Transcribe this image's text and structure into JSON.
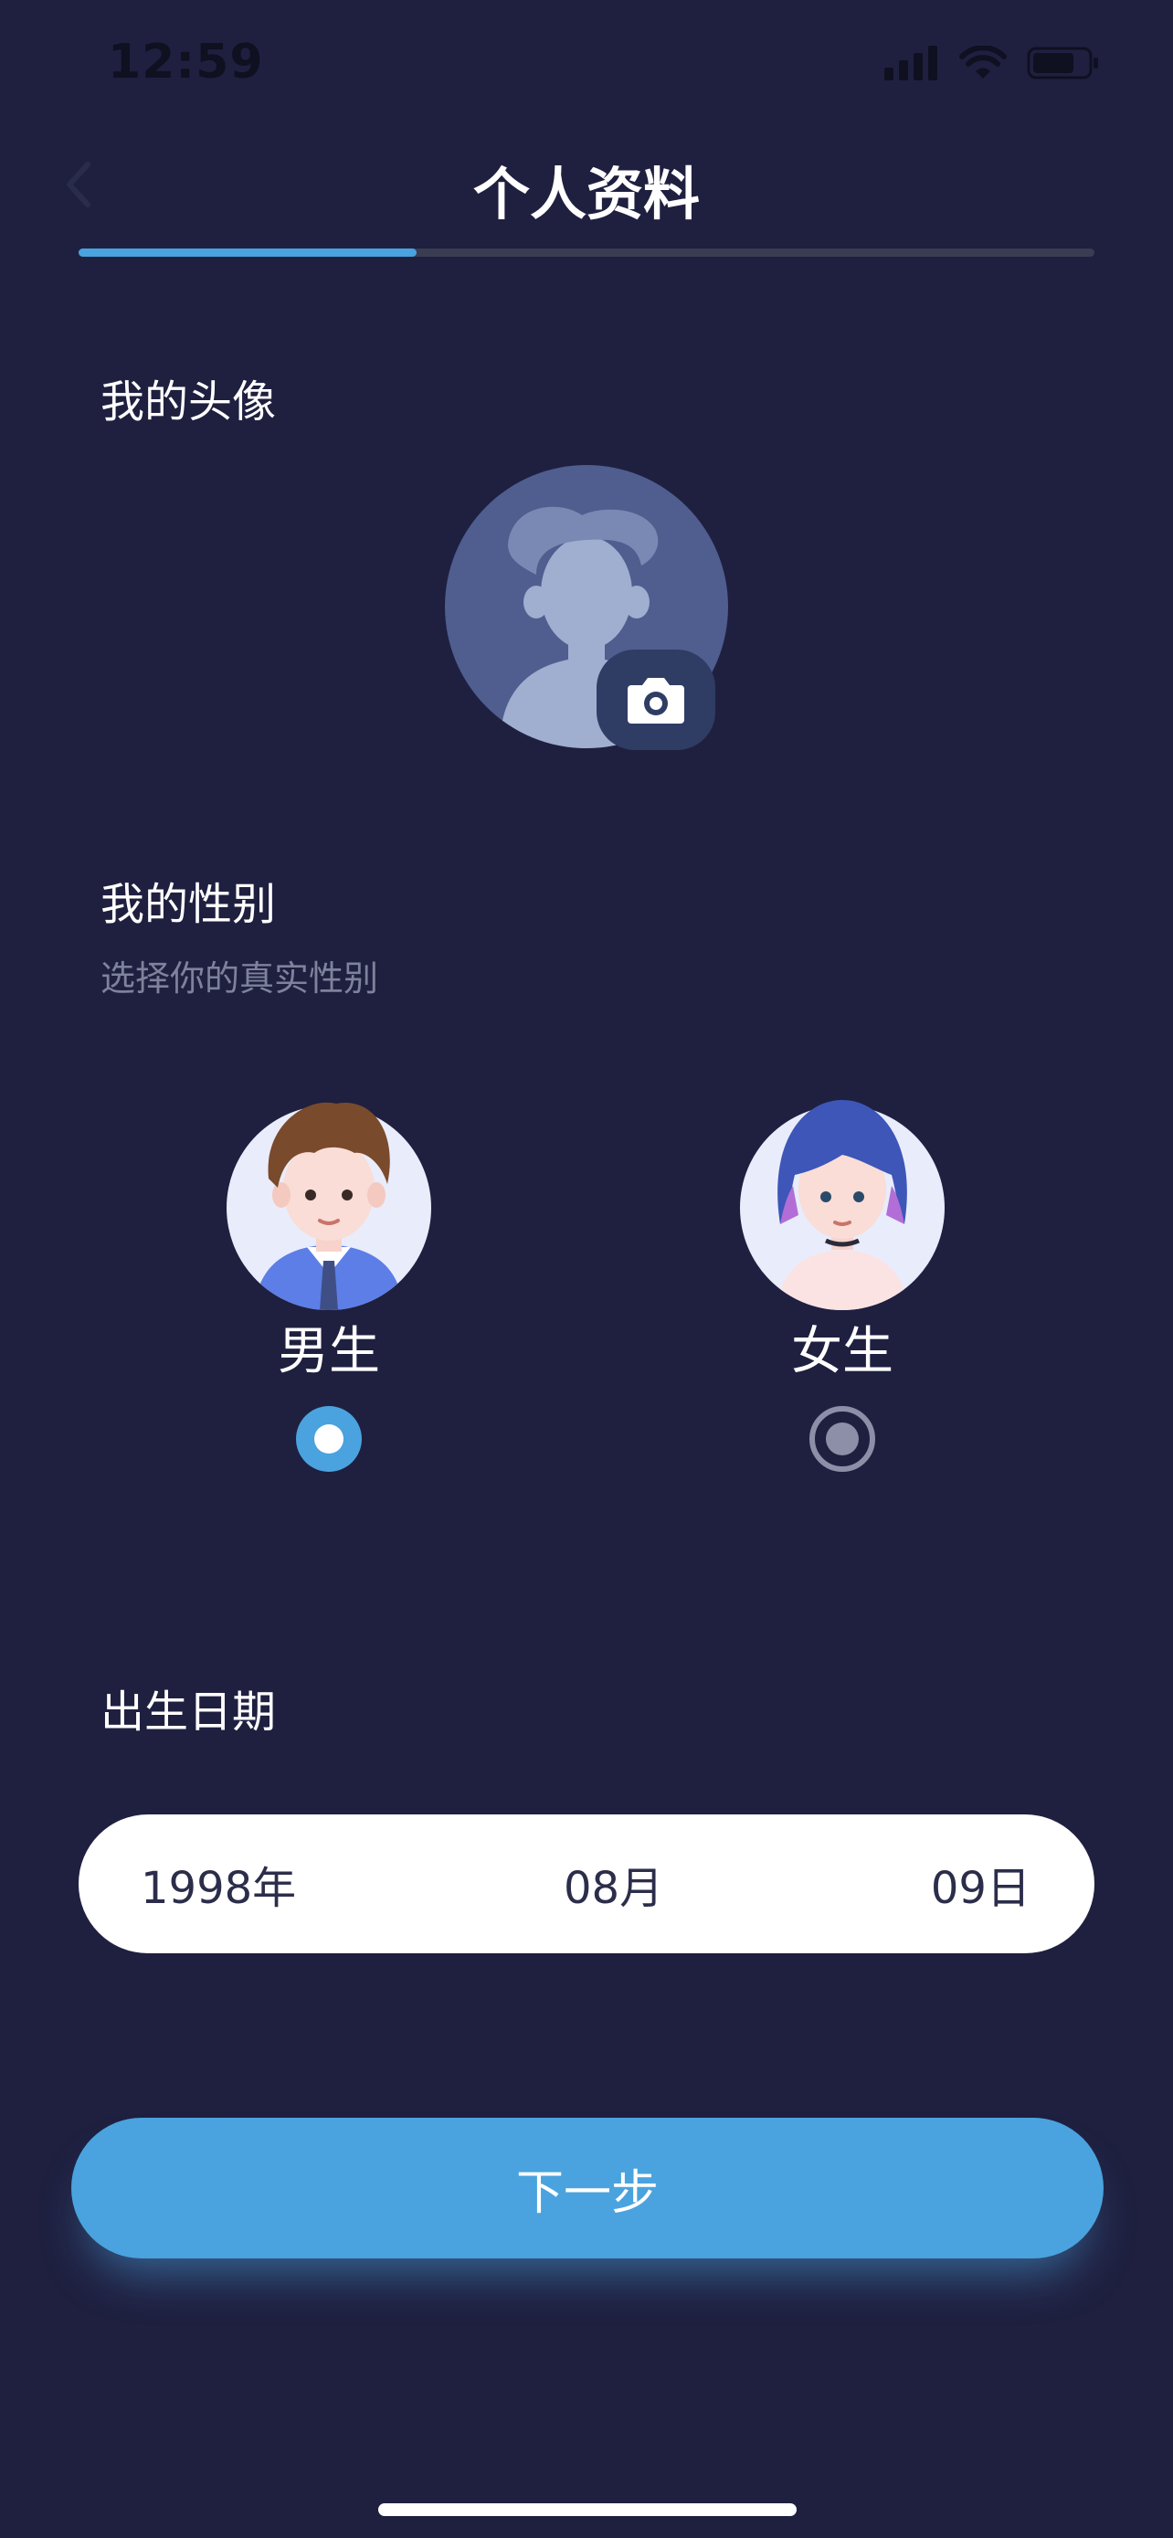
{
  "status": {
    "time": "12:59"
  },
  "header": {
    "title": "个人资料",
    "progress": 0.333
  },
  "avatar_section": {
    "label": "我的头像"
  },
  "gender_section": {
    "label": "我的性别",
    "subtitle": "选择你的真实性别",
    "options": [
      {
        "label": "男生",
        "selected": true
      },
      {
        "label": "女生",
        "selected": false
      }
    ]
  },
  "birth_section": {
    "label": "出生日期",
    "year": "1998年",
    "month": "08月",
    "day": "09日"
  },
  "next_button": {
    "label": "下一步"
  },
  "colors": {
    "background": "#1f2040",
    "accent": "#4aa3de"
  }
}
